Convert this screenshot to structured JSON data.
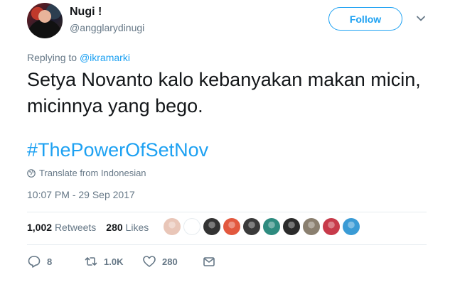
{
  "user": {
    "name": "Nugi !",
    "handle": "@angglarydinugi",
    "follow_label": "Follow"
  },
  "tweet": {
    "reply_prefix": "Replying to ",
    "reply_to": "@ikramarki",
    "text": "Setya Novanto kalo kebanyakan makan micin, micinnya yang bego.",
    "hashtag": "#ThePowerOfSetNov",
    "translate_label": "Translate from Indonesian",
    "timestamp": "10:07 PM - 29 Sep 2017"
  },
  "stats": {
    "retweets_count": "1,002",
    "retweets_label": "Retweets",
    "likes_count": "280",
    "likes_label": "Likes",
    "liker_avatar_colors": [
      "#e9c6b8",
      "#ffffff",
      "#333333",
      "#e2583e",
      "#3a3a3a",
      "#2e8b7f",
      "#2b2b2b",
      "#8a7f6f",
      "#c73a4a",
      "#3a9bd5"
    ]
  },
  "actions": {
    "reply_count": "8",
    "retweet_count": "1.0K",
    "like_count": "280"
  },
  "colors": {
    "accent": "#1da1f2",
    "muted": "#657786",
    "text": "#14171a"
  }
}
